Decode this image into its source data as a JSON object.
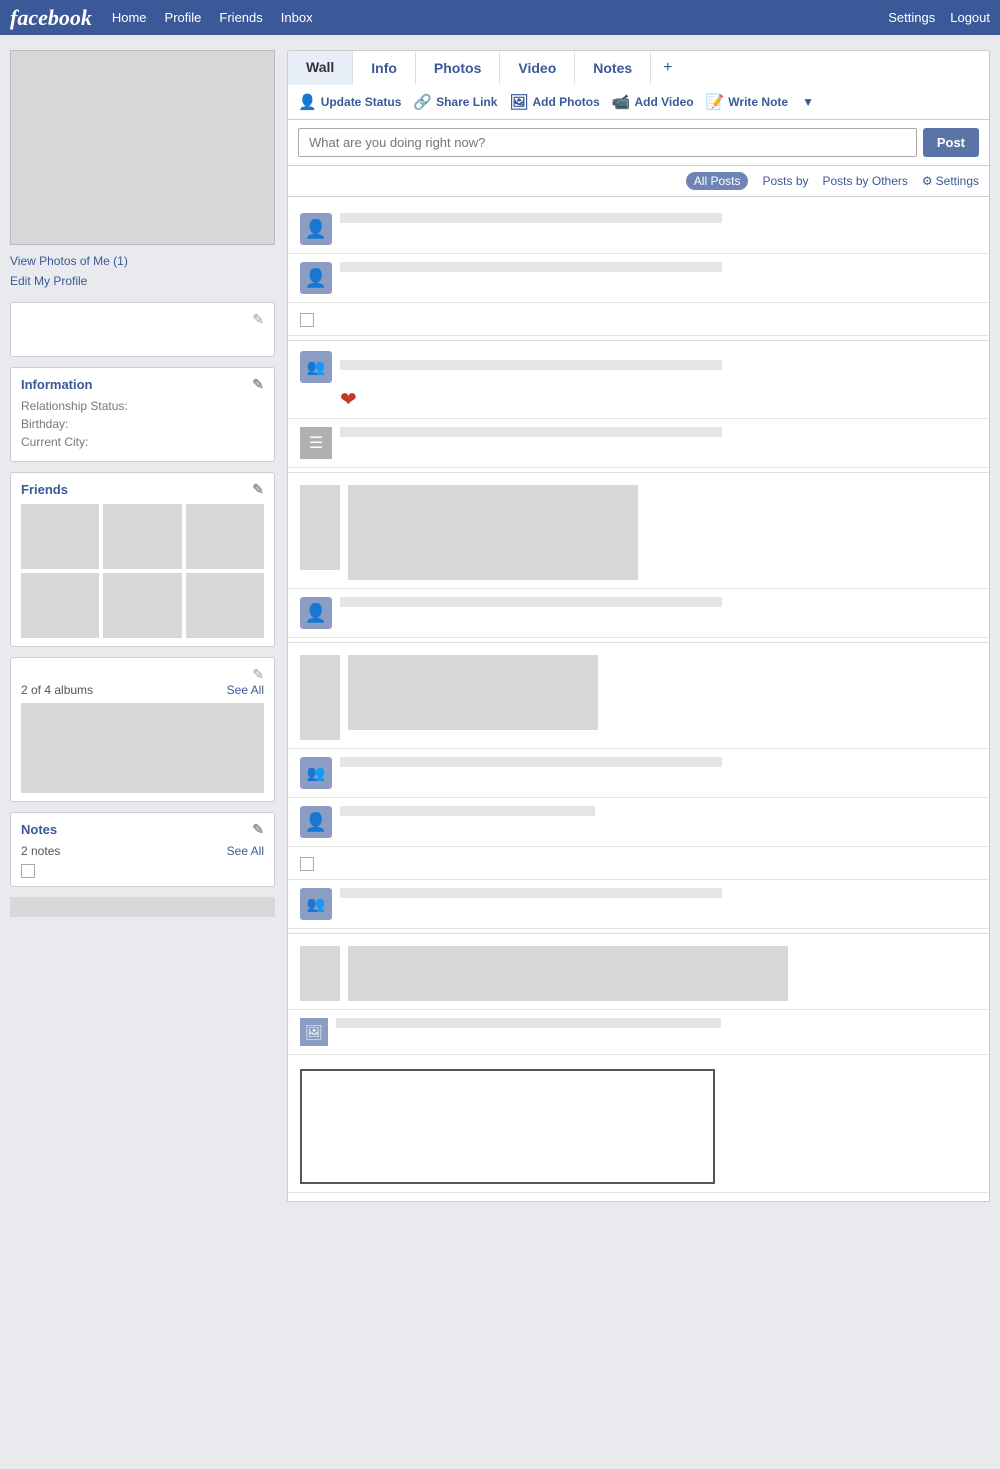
{
  "topnav": {
    "logo": "facebook",
    "links": [
      "Home",
      "Profile",
      "Friends",
      "Inbox"
    ],
    "right_links": [
      "Settings",
      "Logout"
    ]
  },
  "sidebar": {
    "view_photos": "View Photos of Me (1)",
    "edit_profile": "Edit My Profile",
    "info_section": {
      "title": "Information",
      "relationship_label": "Relationship Status:",
      "birthday_label": "Birthday:",
      "city_label": "Current City:"
    },
    "friends_section": {
      "title": "Friends"
    },
    "albums_section": {
      "count": "2 of 4 albums",
      "see_all": "See All"
    },
    "notes_section": {
      "title": "Notes",
      "count": "2 notes",
      "see_all": "See All"
    }
  },
  "tabs": [
    "Wall",
    "Info",
    "Photos",
    "Video",
    "Notes",
    "+"
  ],
  "toolbar": {
    "update_status": "Update Status",
    "share_link": "Share Link",
    "add_photos": "Add Photos",
    "add_video": "Add Video",
    "write_note": "Write Note"
  },
  "status": {
    "placeholder": "What are you doing right now?",
    "post_btn": "Post"
  },
  "filter": {
    "all_posts": "All Posts",
    "posts_by": "Posts by",
    "posts_by_others": "Posts by Others",
    "settings": "Settings"
  }
}
